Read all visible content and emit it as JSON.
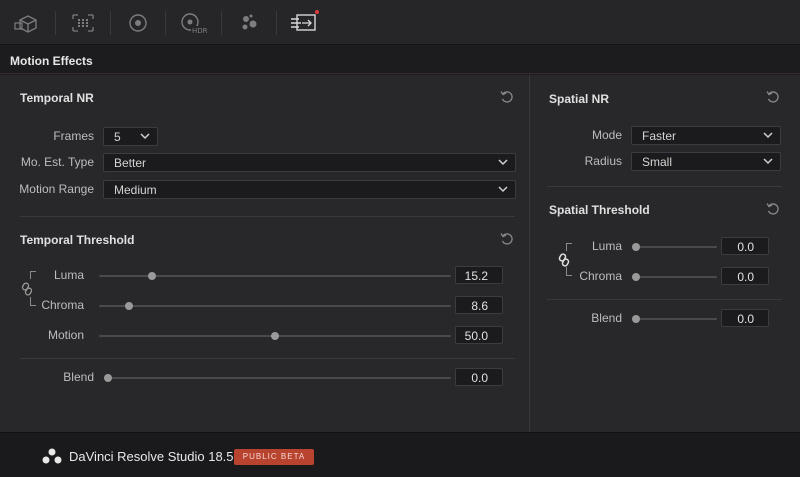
{
  "toolbar": {
    "buttons": [
      {
        "name": "3d-cube-icon"
      },
      {
        "name": "grid-frame-icon"
      },
      {
        "name": "target-circle-icon"
      },
      {
        "name": "hdr-wheel-icon"
      },
      {
        "name": "dots-cluster-icon"
      },
      {
        "name": "motion-effects-icon",
        "active": true
      }
    ]
  },
  "header": {
    "title": "Motion Effects"
  },
  "temporal_nr": {
    "title": "Temporal NR",
    "frames": {
      "label": "Frames",
      "value": "5"
    },
    "mo_est_type": {
      "label": "Mo. Est. Type",
      "value": "Better"
    },
    "motion_range": {
      "label": "Motion Range",
      "value": "Medium"
    }
  },
  "temporal_threshold": {
    "title": "Temporal Threshold",
    "luma": {
      "label": "Luma",
      "value": "15.2",
      "position": 0.15
    },
    "chroma": {
      "label": "Chroma",
      "value": "8.6",
      "position": 0.09
    },
    "motion": {
      "label": "Motion",
      "value": "50.0",
      "position": 0.5
    },
    "blend": {
      "label": "Blend",
      "value": "0.0",
      "position": 0.0
    }
  },
  "spatial_nr": {
    "title": "Spatial NR",
    "mode": {
      "label": "Mode",
      "value": "Faster"
    },
    "radius": {
      "label": "Radius",
      "value": "Small"
    }
  },
  "spatial_threshold": {
    "title": "Spatial Threshold",
    "luma": {
      "label": "Luma",
      "value": "0.0",
      "position": 0.0
    },
    "chroma": {
      "label": "Chroma",
      "value": "0.0",
      "position": 0.0
    },
    "blend": {
      "label": "Blend",
      "value": "0.0",
      "position": 0.0
    }
  },
  "footer": {
    "app_name": "DaVinci Resolve Studio 18.5",
    "badge": "PUBLIC BETA"
  },
  "colors": {
    "accent_badge": "#b8432f",
    "panel_bg": "#28282b"
  }
}
